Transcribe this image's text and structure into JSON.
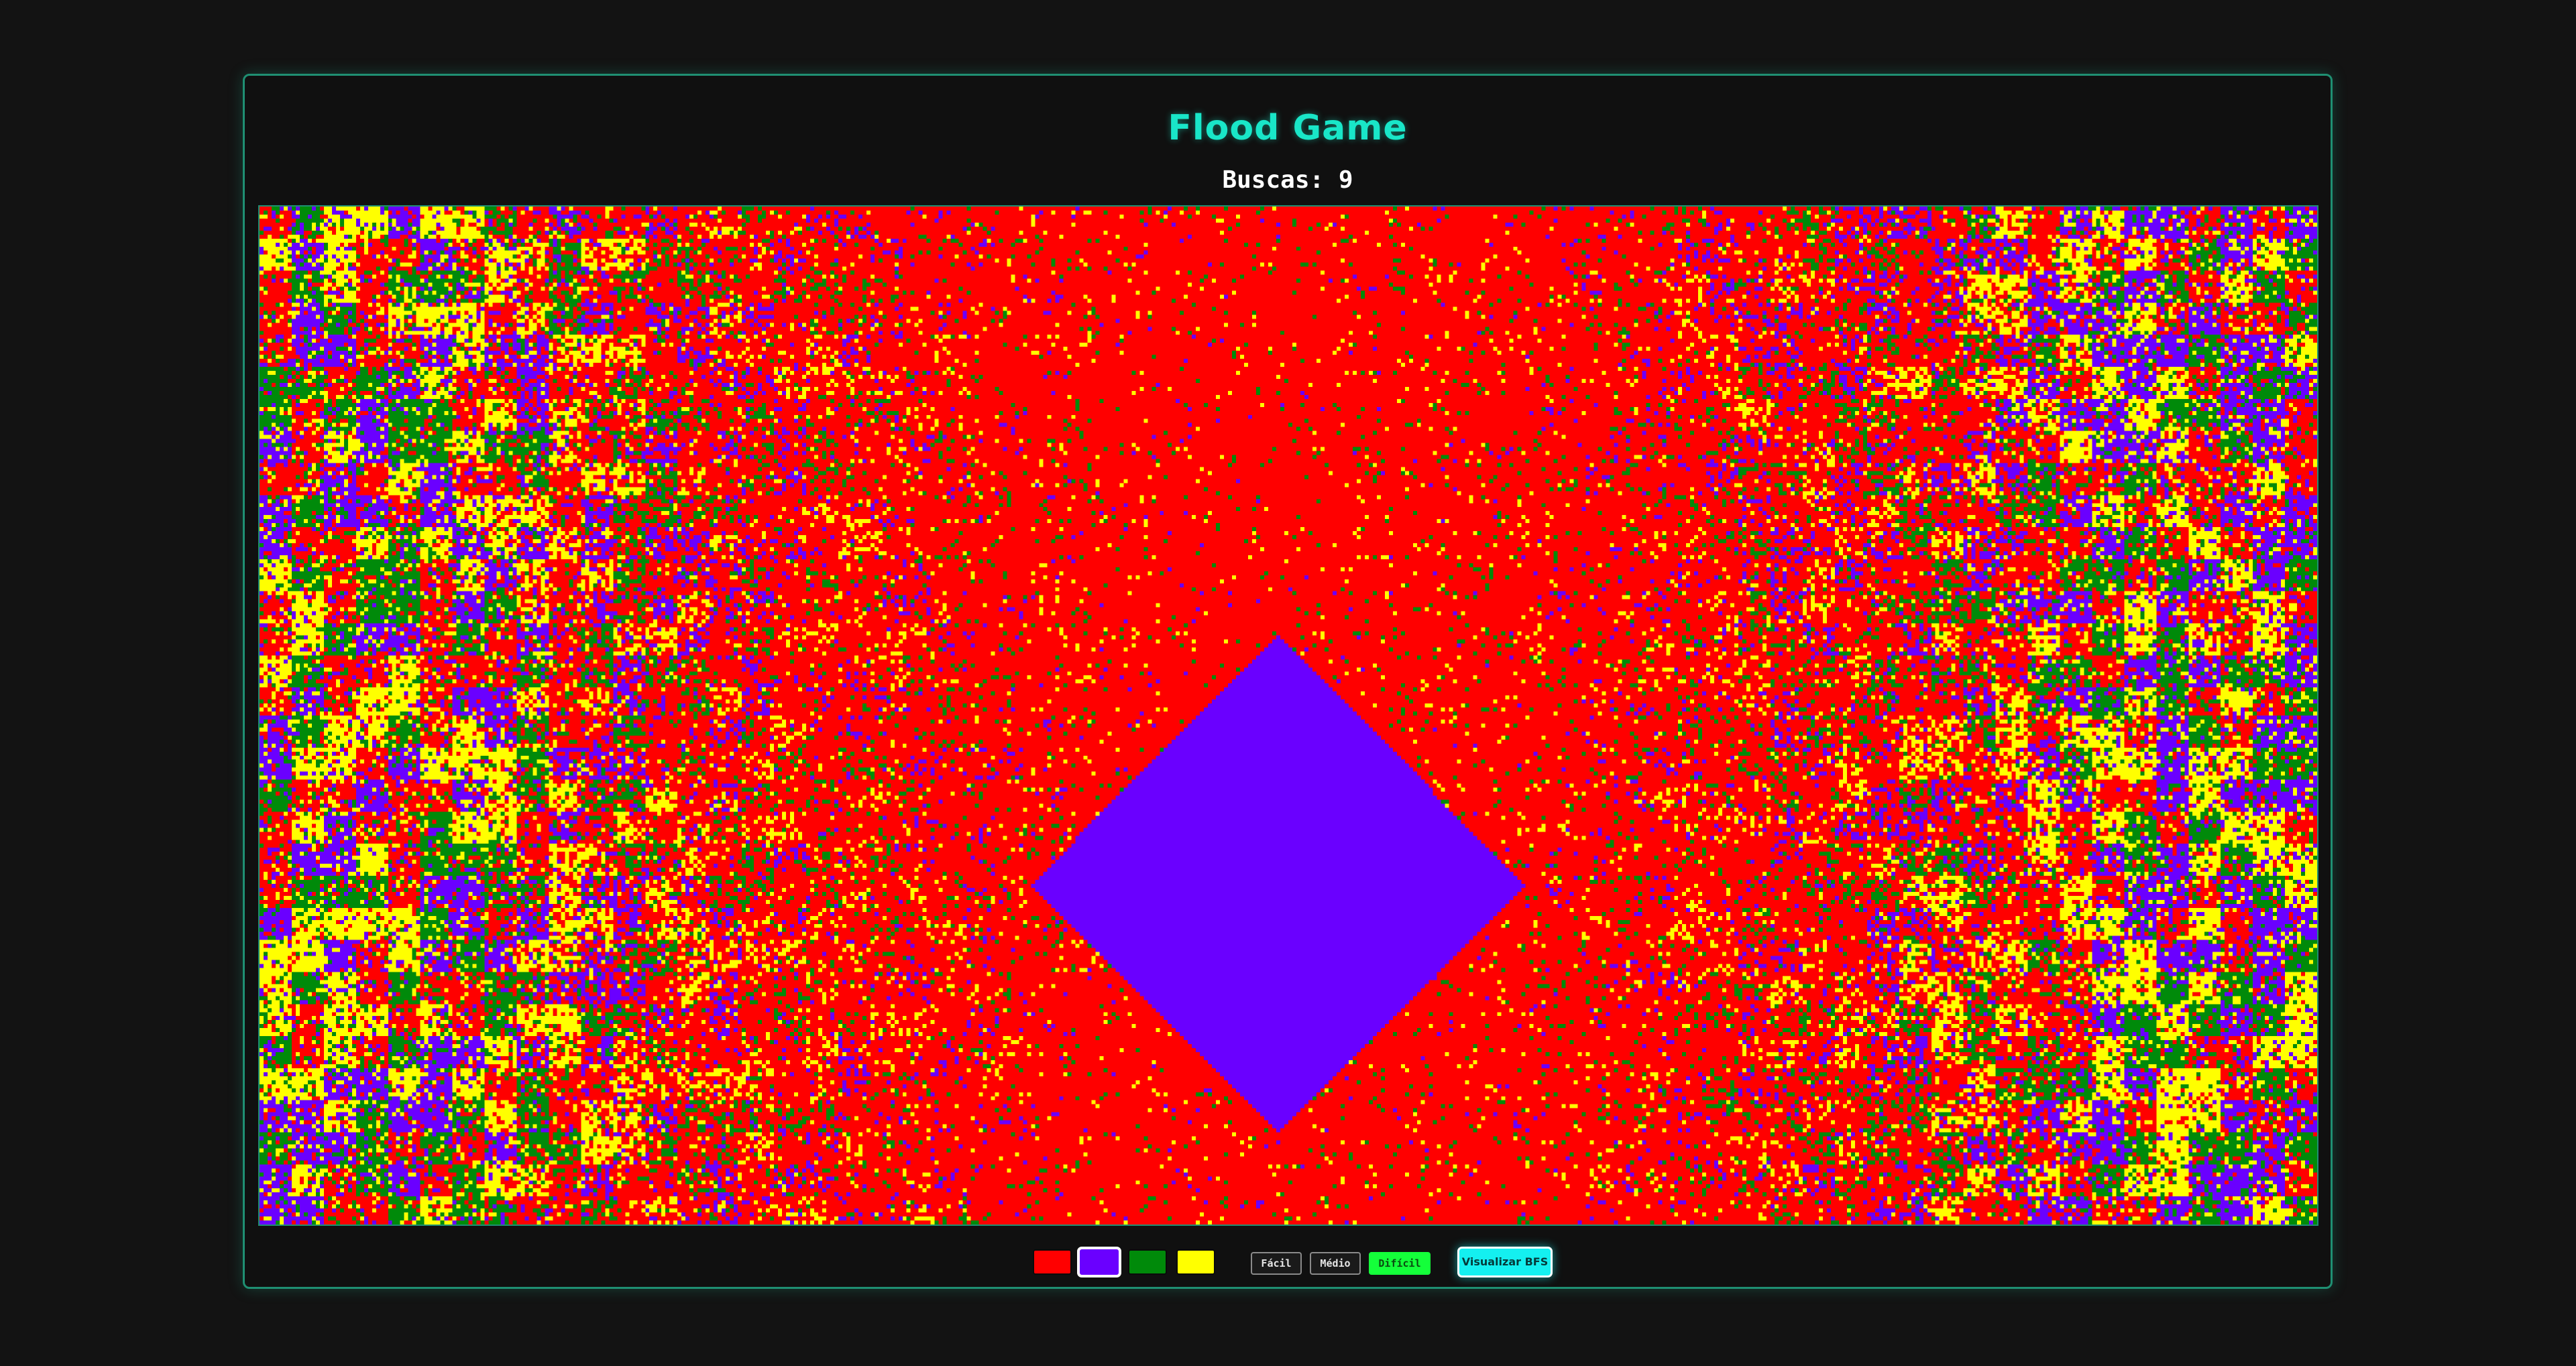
{
  "game": {
    "title": "Flood Game",
    "counter_text": "Buscas: 9"
  },
  "palette": [
    {
      "name": "red",
      "color": "#ff0000",
      "active": false
    },
    {
      "name": "purple",
      "color": "#6a00ff",
      "active": true
    },
    {
      "name": "green",
      "color": "#008a0a",
      "active": false
    },
    {
      "name": "yellow",
      "color": "#ffff00",
      "active": false
    }
  ],
  "difficulty": {
    "easy_label": "Fácil",
    "medium_label": "Médio",
    "hard_label": "Difícil",
    "selected": "hard"
  },
  "bfs_button_label": "Visualizar BFS",
  "colors": {
    "accent": "#19e6c8",
    "border": "#1f8f72",
    "background": "#101010"
  }
}
